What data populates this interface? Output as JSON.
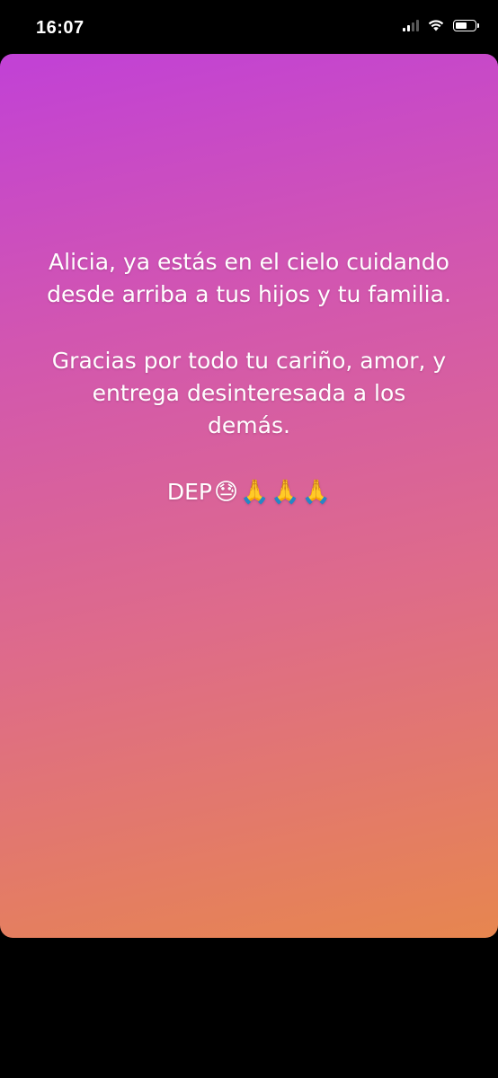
{
  "status_bar": {
    "time": "16:07",
    "signal_bars": 4,
    "signal_bars_active": 2,
    "battery_level_fraction": 0.6,
    "icons": [
      "cellular-signal-icon",
      "wifi-icon",
      "battery-icon"
    ]
  },
  "story": {
    "line1": "Alicia, ya estás en el cielo cuidando",
    "line2": "desde arriba a tus hijos y tu familia.",
    "line3": "Gracias por todo tu cariño, amor, y",
    "line4": "entrega desinteresada a los",
    "line5": "demás.",
    "dep_text": "DEP",
    "emoji_face": "😓",
    "emoji_prayer": "🙏",
    "gradient_colors": [
      "#c141d6",
      "#d256b0",
      "#de6b8a",
      "#e7864f"
    ]
  }
}
